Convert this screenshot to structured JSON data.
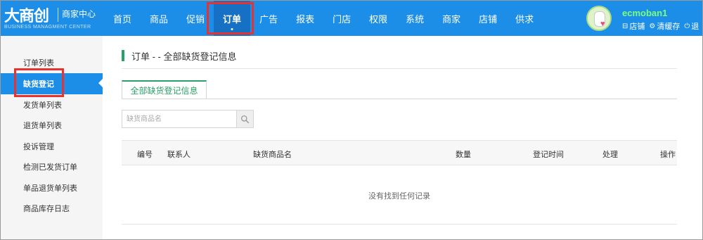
{
  "logo": {
    "main": "大商创",
    "sub": "商家中心",
    "en": "BUSINESS MANAGMENT CENTER"
  },
  "nav": {
    "items": [
      {
        "label": "首页"
      },
      {
        "label": "商品"
      },
      {
        "label": "促销"
      },
      {
        "label": "订单",
        "active": true
      },
      {
        "label": "广告"
      },
      {
        "label": "报表"
      },
      {
        "label": "门店"
      },
      {
        "label": "权限"
      },
      {
        "label": "系统"
      },
      {
        "label": "商家"
      },
      {
        "label": "店铺"
      },
      {
        "label": "供求"
      }
    ]
  },
  "user": {
    "name": "ecmoban1",
    "links": [
      {
        "icon": "store-icon",
        "glyph": "⊟",
        "label": "店铺"
      },
      {
        "icon": "gear-icon",
        "glyph": "⚙",
        "label": "清缓存"
      },
      {
        "icon": "power-icon",
        "glyph": "⏻",
        "label": "退"
      }
    ]
  },
  "sidebar": {
    "items": [
      {
        "label": "订单列表"
      },
      {
        "label": "缺货登记",
        "active": true
      },
      {
        "label": "发货单列表"
      },
      {
        "label": "退货单列表"
      },
      {
        "label": "投诉管理"
      },
      {
        "label": "检测已发货订单"
      },
      {
        "label": "单品退货单列表"
      },
      {
        "label": "商品库存日志"
      }
    ]
  },
  "main": {
    "title": "订单 - - 全部缺货登记信息",
    "tab": "全部缺货登记信息",
    "search": {
      "placeholder": "缺货商品名"
    },
    "table": {
      "headers": [
        "编号",
        "联系人",
        "缺货商品名",
        "数量",
        "登记时间",
        "处理",
        "操作"
      ],
      "empty": "没有找到任何记录"
    }
  },
  "colors": {
    "topbar": "#1c8ee8",
    "nav_active": "#1670c4",
    "accent_green": "#2b9f69",
    "highlight_red": "#e8322f"
  }
}
